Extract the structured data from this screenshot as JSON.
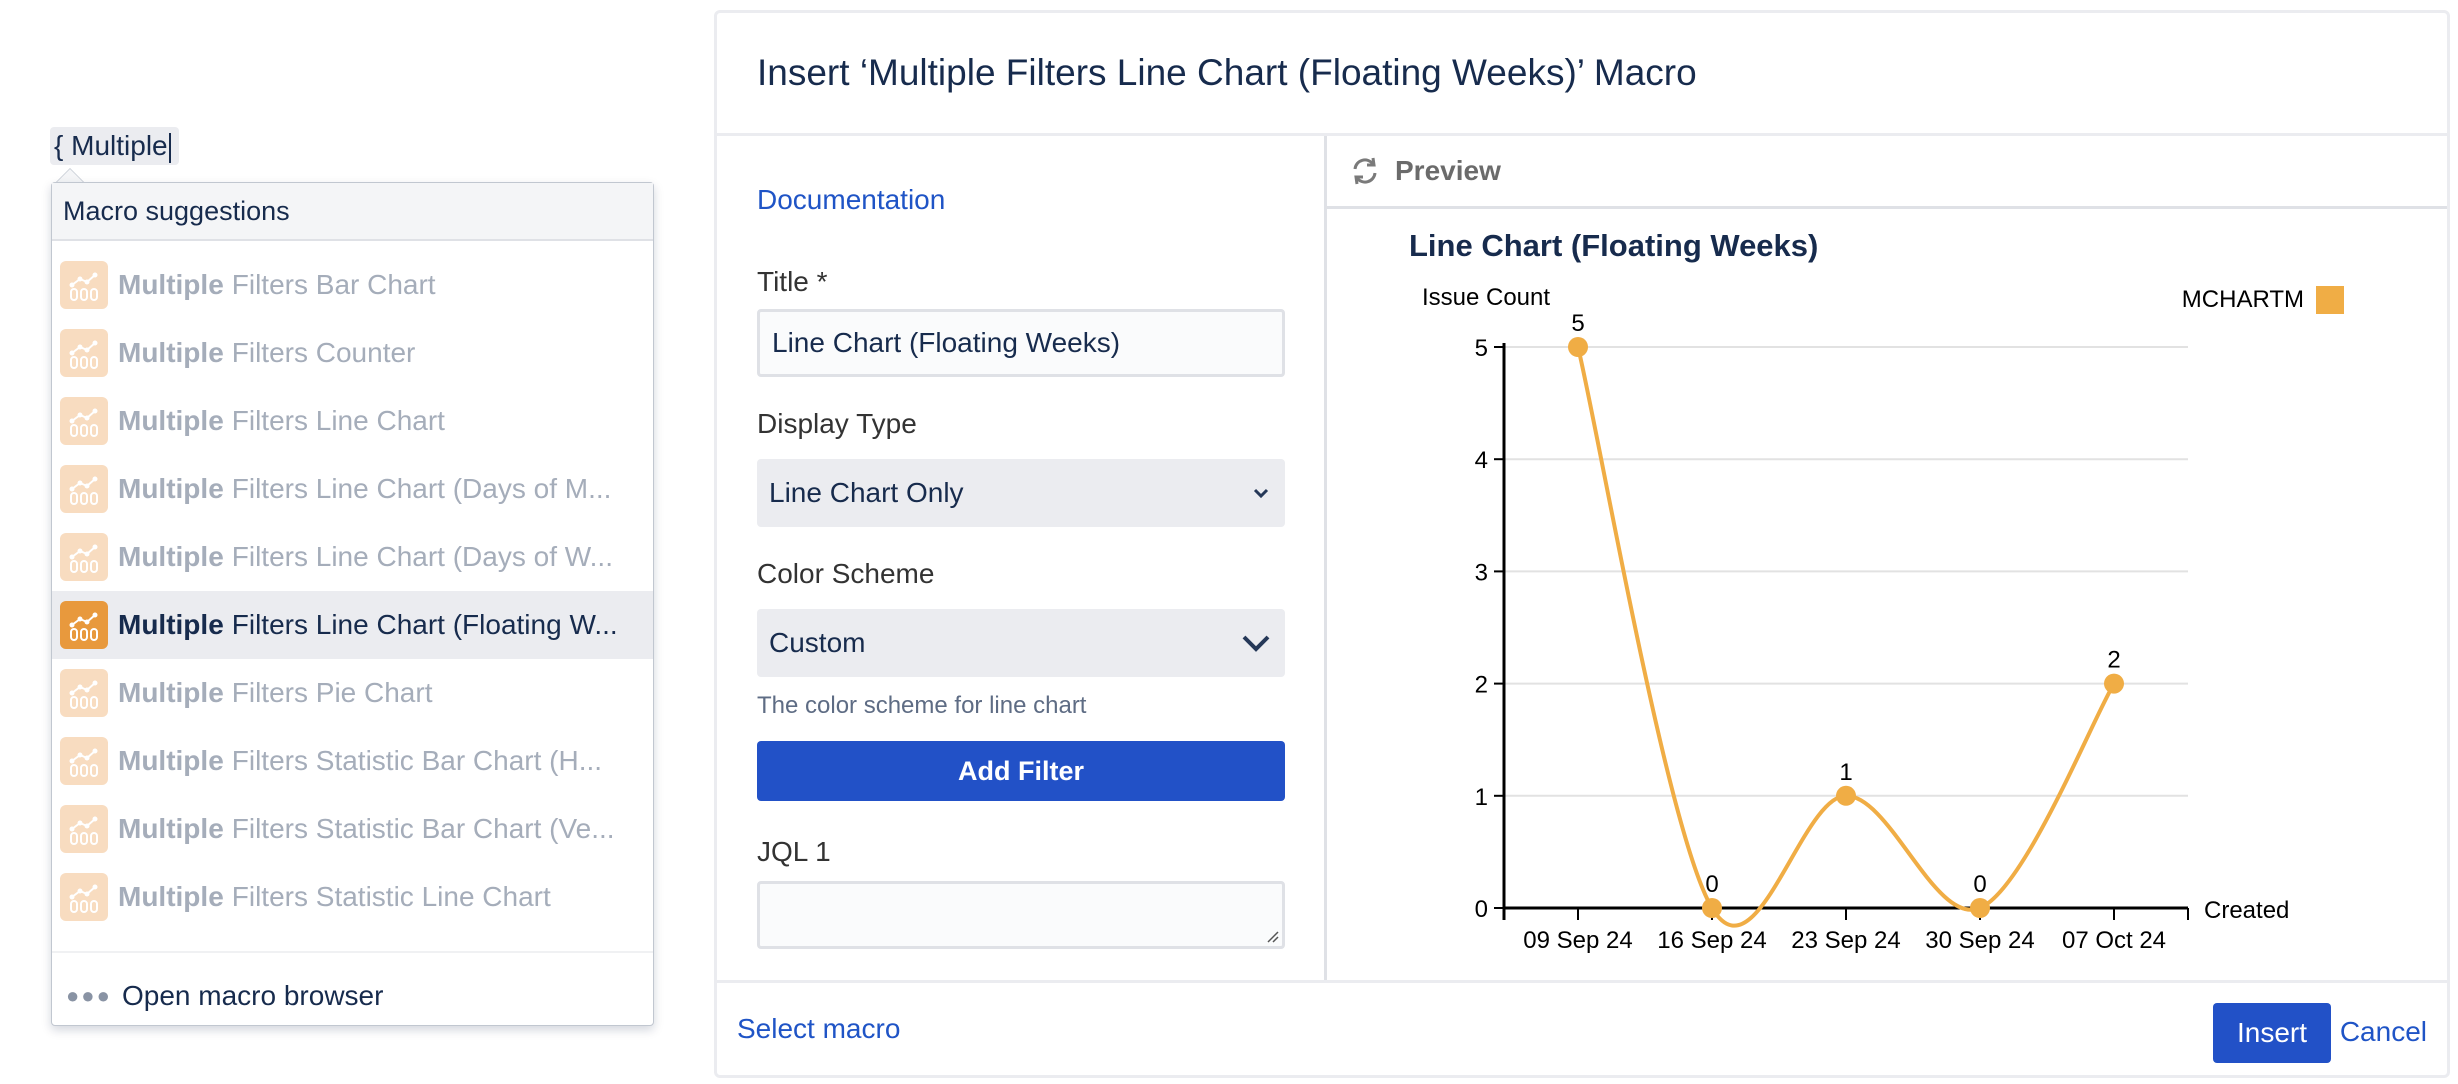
{
  "editor": {
    "token_text": "{ Multiple"
  },
  "suggestions": {
    "header": "Macro suggestions",
    "match": "Multiple",
    "items": [
      {
        "rest": "Filters Bar Chart",
        "selected": false
      },
      {
        "rest": "Filters Counter",
        "selected": false
      },
      {
        "rest": "Filters Line Chart",
        "selected": false
      },
      {
        "rest": "Filters Line Chart (Days of M...",
        "selected": false
      },
      {
        "rest": "Filters Line Chart (Days of W...",
        "selected": false
      },
      {
        "rest": "Filters Line Chart (Floating W...",
        "selected": true
      },
      {
        "rest": "Filters Pie Chart",
        "selected": false
      },
      {
        "rest": "Filters Statistic Bar Chart (H...",
        "selected": false
      },
      {
        "rest": "Filters Statistic Bar Chart (Ve...",
        "selected": false
      },
      {
        "rest": "Filters Statistic Line Chart",
        "selected": false
      }
    ],
    "footer": "Open macro browser",
    "icon": "macro-chart-icon"
  },
  "dialog": {
    "title": "Insert ‘Multiple Filters Line Chart (Floating Weeks)’ Macro",
    "documentation_link": "Documentation",
    "form": {
      "title_label": "Title *",
      "title_value": "Line Chart (Floating Weeks)",
      "display_type_label": "Display Type",
      "display_type_value": "Line Chart Only",
      "color_scheme_label": "Color Scheme",
      "color_scheme_value": "Custom",
      "color_scheme_hint": "The color scheme for line chart",
      "add_filter_label": "Add Filter",
      "jql_label": "JQL 1",
      "jql_value": ""
    },
    "preview": {
      "header": "Preview"
    },
    "footer": {
      "select_macro": "Select macro",
      "insert": "Insert",
      "cancel": "Cancel"
    }
  },
  "colors": {
    "accent": "#2251c7",
    "series": "#f0ad45",
    "link": "#1f54c6"
  },
  "chart_data": {
    "type": "line",
    "title": "Line Chart (Floating Weeks)",
    "xlabel": "Created",
    "ylabel": "Issue Count",
    "categories": [
      "09 Sep 24",
      "16 Sep 24",
      "23 Sep 24",
      "30 Sep 24",
      "07 Oct 24"
    ],
    "series": [
      {
        "name": "MCHARTM",
        "values": [
          5,
          0,
          1,
          0,
          2
        ],
        "color": "#f0ad45"
      }
    ],
    "yticks": [
      0,
      1,
      2,
      3,
      4,
      5
    ],
    "ylim": [
      0,
      5
    ],
    "grid": true,
    "legend": "top-right",
    "data_labels": true,
    "curve": "smooth"
  }
}
